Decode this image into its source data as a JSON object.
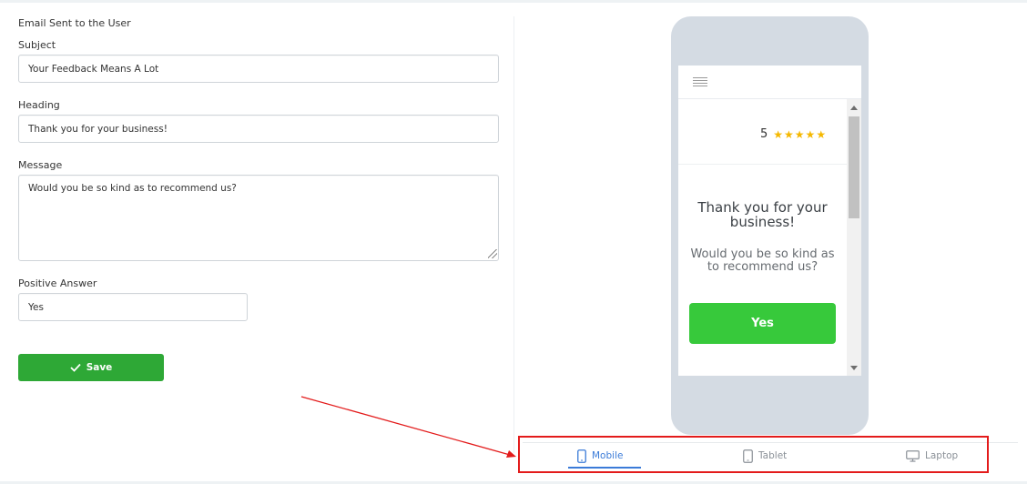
{
  "form": {
    "section_title": "Email Sent to the User",
    "subject_label": "Subject",
    "subject_value": "Your Feedback Means A Lot",
    "heading_label": "Heading",
    "heading_value": "Thank you for your business!",
    "message_label": "Message",
    "message_value": "Would you be so kind as to recommend us?",
    "positive_label": "Positive Answer",
    "positive_value": "Yes",
    "save_label": "Save"
  },
  "preview": {
    "rating_value": "5",
    "stars": "★★★★★",
    "heading": "Thank you for your business!",
    "message": "Would you be so kind as to recommend us?",
    "button_label": "Yes"
  },
  "devices": {
    "mobile": "Mobile",
    "tablet": "Tablet",
    "laptop": "Laptop",
    "active": "mobile"
  },
  "colors": {
    "accent": "#3b7bd8",
    "save_button": "#2ea836",
    "preview_button": "#37c93b",
    "stars": "#f5b800",
    "annotation": "#e31b1b"
  },
  "icons": {
    "save": "checkmark-icon",
    "menu": "hamburger-menu-icon",
    "mobile": "mobile-phone-icon",
    "tablet": "tablet-icon",
    "laptop": "monitor-icon"
  }
}
